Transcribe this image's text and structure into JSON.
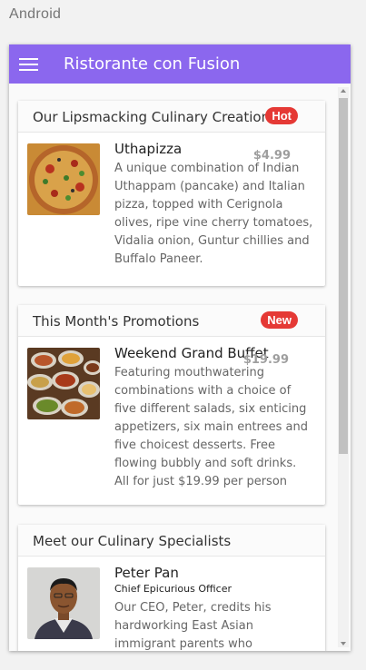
{
  "platform": "Android",
  "toolbar": {
    "title": "Ristorante con Fusion",
    "menu_icon": "hamburger-menu-icon"
  },
  "cards": [
    {
      "header": "Our Lipsmacking Culinary Creations",
      "badge": "Hot",
      "badge_color": "#e53935",
      "name": "Uthapizza",
      "price": "$4.99",
      "description": "A unique combination of Indian Uthappam (pancake) and Italian pizza, topped with Cerignola olives, ripe vine cherry tomatoes, Vidalia onion, Guntur chillies and Buffalo Paneer."
    },
    {
      "header": "This Month's Promotions",
      "badge": "New",
      "badge_color": "#e53935",
      "name": "Weekend Grand Buffet",
      "price": "$19.99",
      "description": "Featuring mouthwatering combinations with a choice of five different salads, six enticing appetizers, six main entrees and five choicest desserts. Free flowing bubbly and soft drinks. All for just $19.99 per person"
    },
    {
      "header": "Meet our Culinary Specialists",
      "name": "Peter Pan",
      "subtitle": "Chief Epicurious Officer",
      "description": "Our CEO, Peter, credits his hardworking East Asian immigrant parents who undertook the"
    }
  ],
  "colors": {
    "toolbar": "#8b67ee",
    "badge": "#e53935",
    "price": "#9e9e9e"
  }
}
